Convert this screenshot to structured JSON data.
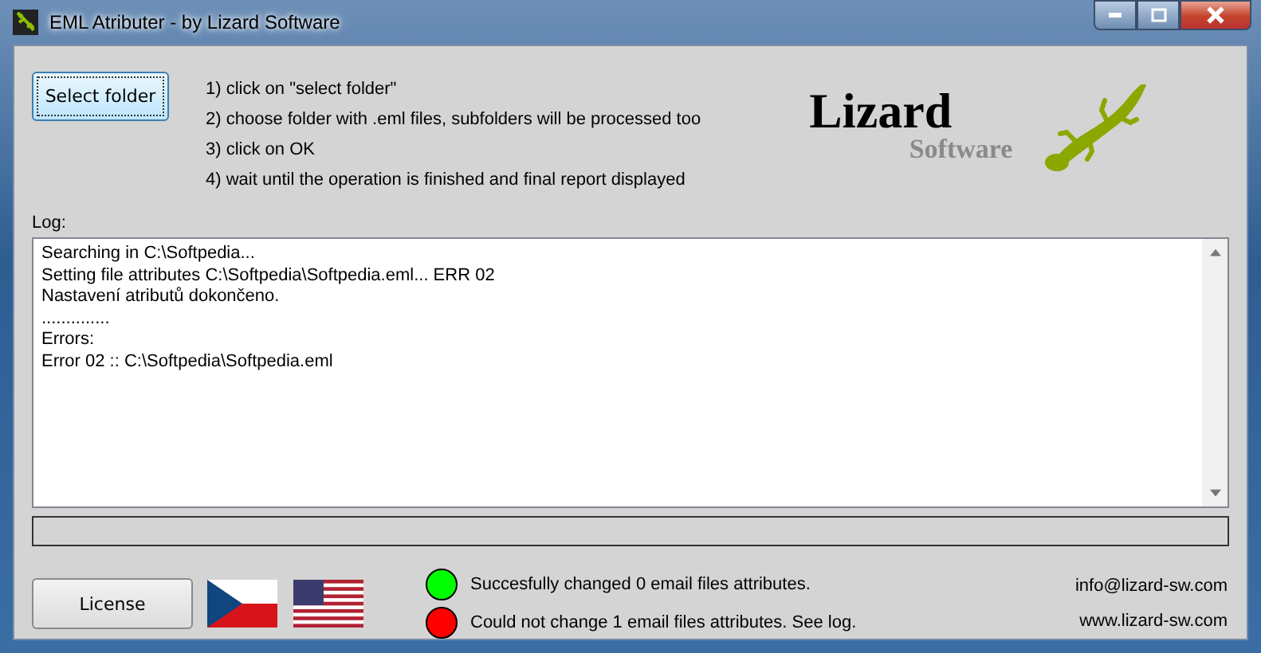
{
  "window": {
    "title": "EML Atributer - by Lizard Software"
  },
  "select_button": "Select folder",
  "instructions": [
    "1) click on \"select folder\"",
    "2) choose folder with .eml files, subfolders will be processed too",
    "3) click on OK",
    "4) wait until the operation is finished and final report displayed"
  ],
  "logo": {
    "name": "Lizard",
    "subtitle": "Software"
  },
  "log": {
    "label": "Log:",
    "lines": [
      "Searching in C:\\Softpedia...",
      "Setting file attributes C:\\Softpedia\\Softpedia.eml... ERR 02",
      "Nastavení atributů dokončeno.",
      "..............",
      "Errors:",
      "Error 02 :: C:\\Softpedia\\Softpedia.eml"
    ]
  },
  "license_button": "License",
  "status": [
    {
      "text": "Succesfully changed 0 email files attributes.",
      "color": "#00ff00"
    },
    {
      "text": "Could not change 1 email files attributes. See log.",
      "color": "#ff0000"
    }
  ],
  "links": [
    "info@lizard-sw.com",
    "www.lizard-sw.com"
  ]
}
